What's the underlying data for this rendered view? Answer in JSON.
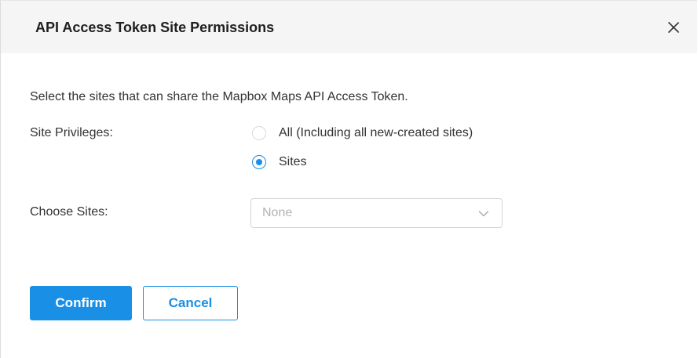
{
  "dialog": {
    "title": "API Access Token Site Permissions",
    "close_icon": "close-icon",
    "description": "Select the sites that can share the Mapbox Maps API Access Token."
  },
  "form": {
    "site_privileges_label": "Site Privileges:",
    "privilege_options": [
      {
        "label": "All (Including all new-created sites)",
        "selected": false
      },
      {
        "label": "Sites",
        "selected": true
      }
    ],
    "choose_sites_label": "Choose Sites:",
    "choose_sites_value": "None",
    "choose_sites_icon": "chevron-down-icon"
  },
  "actions": {
    "confirm_label": "Confirm",
    "cancel_label": "Cancel"
  },
  "colors": {
    "accent": "#1a8fe6",
    "header_bg": "#f5f5f6",
    "text": "#333333",
    "placeholder": "#b3b3b3"
  }
}
